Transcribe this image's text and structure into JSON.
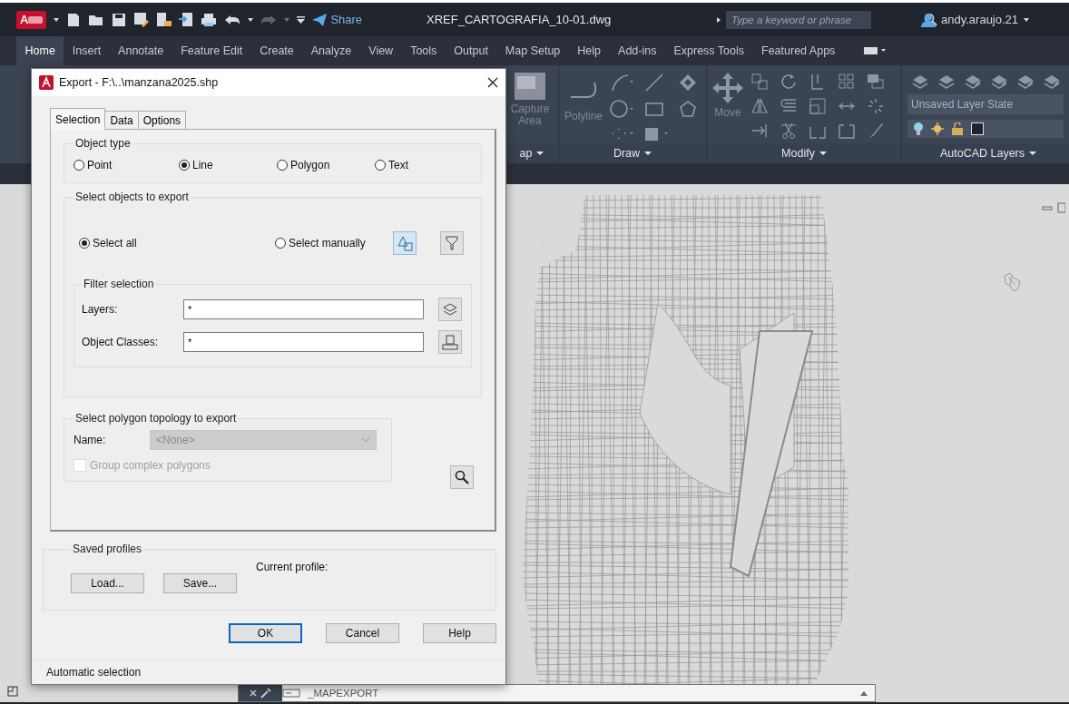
{
  "title_bar": {
    "logo": "A",
    "share": "Share",
    "file_title": "XREF_CARTOGRAFIA_10-01.dwg",
    "search": {
      "placeholder": "Type a keyword or phrase"
    },
    "user": "andy.araujo.21"
  },
  "ribbon_tabs": [
    {
      "label": "Home",
      "selected": true
    },
    {
      "label": "Insert",
      "selected": false
    },
    {
      "label": "Annotate",
      "selected": false
    },
    {
      "label": "Feature Edit",
      "selected": false
    },
    {
      "label": "Create",
      "selected": false
    },
    {
      "label": "Analyze",
      "selected": false
    },
    {
      "label": "View",
      "selected": false
    },
    {
      "label": "Tools",
      "selected": false
    },
    {
      "label": "Output",
      "selected": false
    },
    {
      "label": "Map Setup",
      "selected": false
    },
    {
      "label": "Help",
      "selected": false
    },
    {
      "label": "Add-ins",
      "selected": false
    },
    {
      "label": "Express Tools",
      "selected": false
    },
    {
      "label": "Featured Apps",
      "selected": false
    }
  ],
  "ribbon_panels": [
    {
      "kind": "capture",
      "button": "Capture Area",
      "label": "ap"
    },
    {
      "kind": "draw",
      "button": "Polyline",
      "label": "Draw"
    },
    {
      "kind": "modify",
      "button": "Move",
      "label": "Modify"
    },
    {
      "kind": "layers",
      "layer_state": "Unsaved Layer State",
      "label": "AutoCAD Layers"
    }
  ],
  "dialog": {
    "title": "Export - F:\\..\\manzana2025.shp",
    "tabs": [
      {
        "label": "Selection",
        "selected": true
      },
      {
        "label": "Data",
        "selected": false
      },
      {
        "label": "Options",
        "selected": false
      }
    ],
    "object_type": {
      "label": "Object type",
      "options": [
        {
          "label": "Point",
          "selected": false
        },
        {
          "label": "Line",
          "selected": true
        },
        {
          "label": "Polygon",
          "selected": false
        },
        {
          "label": "Text",
          "selected": false
        }
      ]
    },
    "select_objects": {
      "label": "Select objects to export",
      "options": [
        {
          "label": "Select all",
          "selected": true
        },
        {
          "label": "Select manually",
          "selected": false
        }
      ],
      "filter": {
        "label": "Filter selection",
        "fields": [
          {
            "label": "Layers:",
            "value": "*"
          },
          {
            "label": "Object Classes:",
            "value": "*"
          }
        ]
      }
    },
    "topology": {
      "label": "Select polygon topology to export",
      "name_label": "Name:",
      "name_value": "<None>",
      "disabled": true,
      "group_complex": {
        "label": "Group complex polygons",
        "checked": false,
        "disabled": true
      }
    },
    "saved_profiles": {
      "label": "Saved profiles",
      "buttons": [
        "Load...",
        "Save..."
      ],
      "current_profile": "Current profile:"
    },
    "buttons": [
      {
        "label": "OK",
        "default": true
      },
      {
        "label": "Cancel",
        "default": false
      },
      {
        "label": "Help",
        "default": false
      }
    ],
    "status": "Automatic selection"
  },
  "command_line": {
    "value": "_MAPEXPORT"
  }
}
